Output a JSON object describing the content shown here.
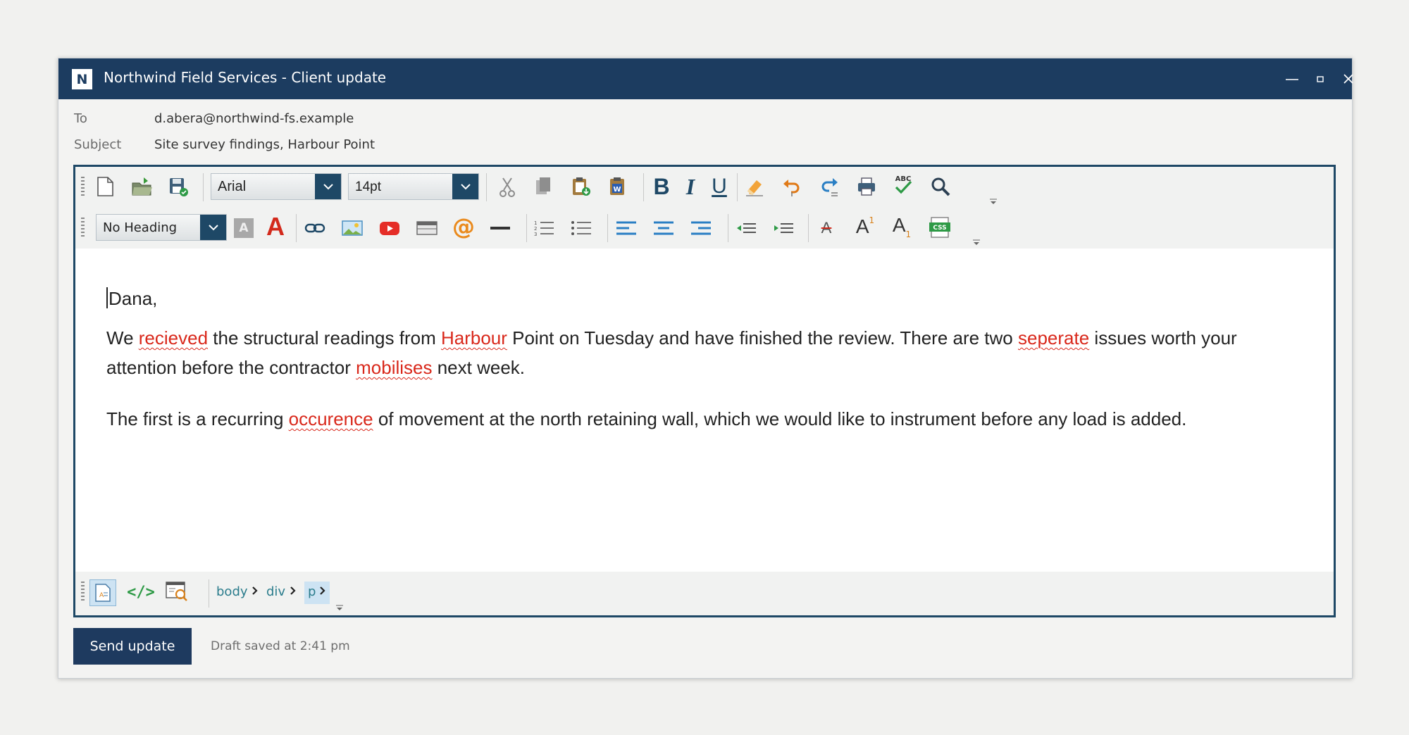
{
  "window": {
    "logo_letter": "N",
    "title": "Northwind Field Services - Client update",
    "controls": {
      "minimize": "—",
      "maximize": "▫",
      "close": "✕"
    }
  },
  "header": {
    "to_label": "To",
    "to_value": "d.abera@northwind-fs.example",
    "subject_label": "Subject",
    "subject_value": "Site survey findings, Harbour Point"
  },
  "toolbar1": {
    "font_name": "Arial",
    "font_size": "14pt",
    "icons": [
      "new-document-icon",
      "open-folder-icon",
      "save-icon",
      "cut-icon",
      "copy-icon",
      "paste-icon",
      "paste-from-word-icon",
      "bold-icon",
      "italic-icon",
      "underline-icon",
      "clear-formatting-icon",
      "undo-icon",
      "redo-icon",
      "print-icon",
      "spellcheck-icon",
      "find-icon"
    ],
    "bold_glyph": "B",
    "italic_glyph": "I",
    "underline_glyph": "U",
    "spell_glyph": "ABC"
  },
  "toolbar2": {
    "heading_value": "No Heading",
    "highlight_glyph": "A",
    "font_color_glyph": "A",
    "mention_glyph": "@",
    "strike_glyph": "A",
    "superscript_glyph": "A",
    "superscript_mark": "1",
    "subscript_glyph": "A",
    "subscript_mark": "1",
    "css_glyph": "CSS",
    "icons": [
      "background-color-icon",
      "font-color-icon",
      "link-icon",
      "image-icon",
      "youtube-icon",
      "table-icon",
      "mention-icon",
      "horizontal-rule-icon",
      "numbered-list-icon",
      "bulleted-list-icon",
      "align-left-icon",
      "align-center-icon",
      "align-right-icon",
      "outdent-icon",
      "indent-icon",
      "strikethrough-icon",
      "superscript-icon",
      "subscript-icon",
      "css-icon"
    ]
  },
  "body": {
    "greeting": "Dana,",
    "p1": [
      {
        "t": "We "
      },
      {
        "t": "recieved",
        "err": true
      },
      {
        "t": " the structural readings from "
      },
      {
        "t": "Harbour",
        "err": true
      },
      {
        "t": " Point on Tuesday and have finished the review. There are two "
      },
      {
        "t": "seperate",
        "err": true
      },
      {
        "t": " issues worth your attention before the contractor "
      },
      {
        "t": "mobilises",
        "err": true
      },
      {
        "t": " next week."
      }
    ],
    "p2": [
      {
        "t": "The first is a recurring "
      },
      {
        "t": "occurence",
        "err": true
      },
      {
        "t": " of movement at the north retaining wall, which we would like to instrument before any load is added."
      }
    ]
  },
  "bottom_toolbar": {
    "modes": [
      "design-mode-icon",
      "code-mode-icon",
      "preview-mode-icon"
    ],
    "code_glyph": "</>",
    "breadcrumb": [
      "body",
      "div",
      "p"
    ]
  },
  "footer": {
    "send_label": "Send update",
    "draft_status": "Draft saved at 2:41 pm"
  },
  "colors": {
    "title_bar": "#1c3c60",
    "editor_border": "#1e4866",
    "spell_error": "#d9281b",
    "send_button": "#1e3a5f"
  }
}
